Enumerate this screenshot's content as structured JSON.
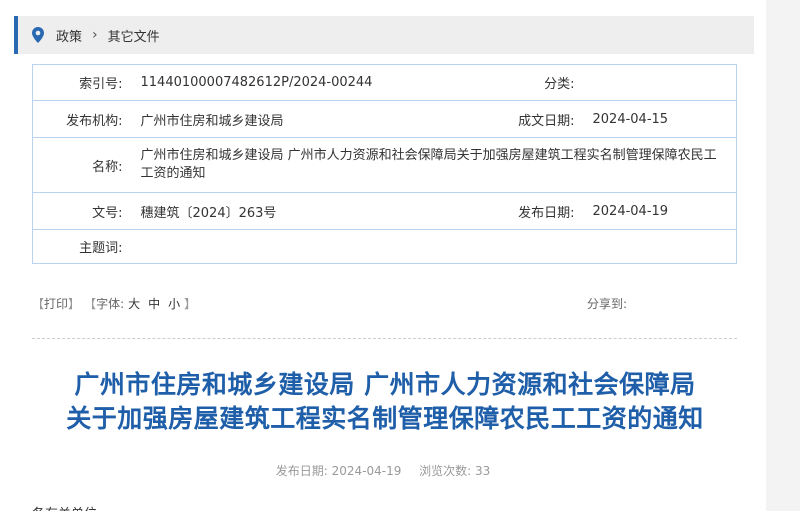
{
  "breadcrumb": {
    "items": [
      "政策",
      "其它文件"
    ],
    "separator": "›"
  },
  "info": {
    "index_no_label": "索引号:",
    "index_no": "11440100007482612P/2024-00244",
    "category_label": "分类:",
    "category": "",
    "publisher_label": "发布机构:",
    "publisher": "广州市住房和城乡建设局",
    "written_date_label": "成文日期:",
    "written_date": "2024-04-15",
    "name_label": "名称:",
    "name": "广州市住房和城乡建设局 广州市人力资源和社会保障局关于加强房屋建筑工程实名制管理保障农民工工资的通知",
    "doc_no_label": "文号:",
    "doc_no": "穗建筑〔2024〕263号",
    "publish_date_label": "发布日期:",
    "publish_date": "2024-04-19",
    "keywords_label": "主题词:",
    "keywords": ""
  },
  "tools": {
    "print_open": "【",
    "print": "打印",
    "print_close": "】",
    "font_open": "【",
    "font_label": "字体:",
    "font_large": "大",
    "font_medium": "中",
    "font_small": "小",
    "font_close": "】",
    "share_label": "分享到:"
  },
  "article": {
    "title_line1": "广州市住房和城乡建设局 广州市人力资源和社会保障局",
    "title_line2": "关于加强房屋建筑工程实名制管理保障农民工工资的通知",
    "publish_date_label": "发布日期:",
    "publish_date": "2024-04-19",
    "views_label": "浏览次数:",
    "views": "33",
    "body_start": "各有关单位"
  },
  "colors": {
    "accent": "#2a68b2",
    "title": "#1f5ea8",
    "table_border": "#b7d3ee"
  }
}
